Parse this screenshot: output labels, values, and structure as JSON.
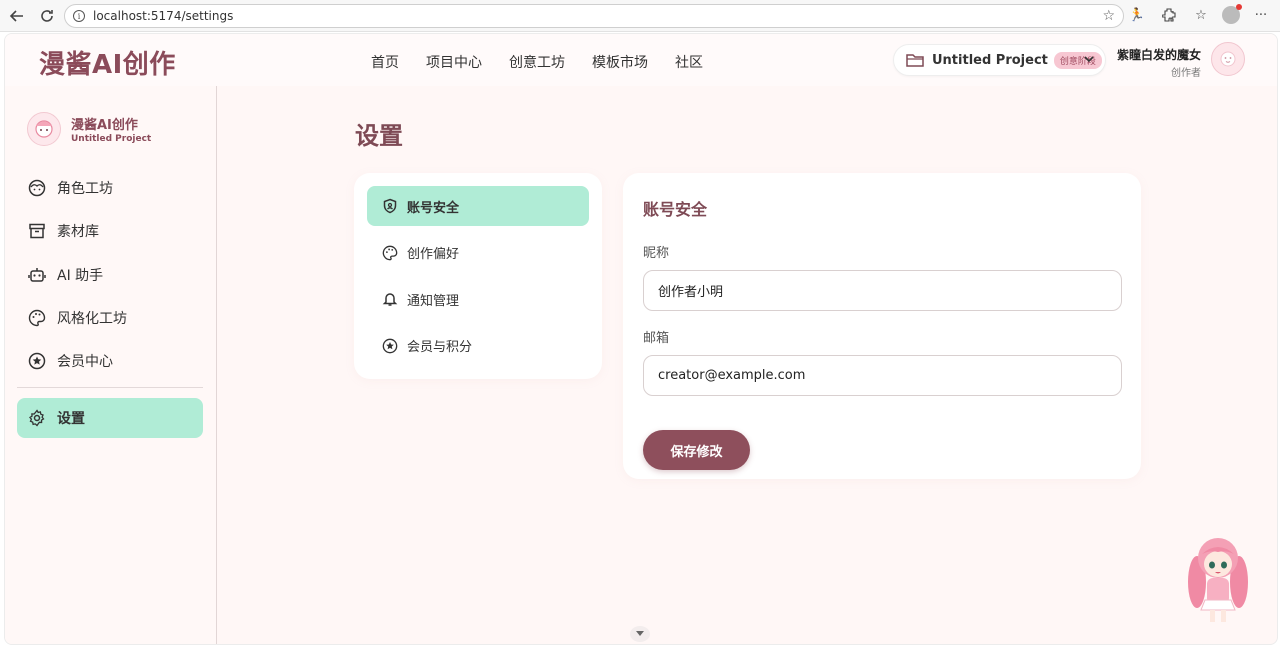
{
  "browser": {
    "url": "localhost:5174/settings"
  },
  "header": {
    "brand": "漫酱AI创作",
    "nav": [
      "首页",
      "项目中心",
      "创意工坊",
      "模板市场",
      "社区"
    ],
    "project": {
      "name": "Untitled Project",
      "stage": "创意阶段"
    },
    "user": {
      "name": "紫瞳白发的魔女",
      "role": "创作者"
    }
  },
  "sidebar": {
    "brand": "漫酱AI创作",
    "project": "Untitled Project",
    "items": [
      {
        "label": "角色工坊",
        "icon": "face-icon"
      },
      {
        "label": "素材库",
        "icon": "archive-icon"
      },
      {
        "label": "AI 助手",
        "icon": "robot-icon"
      },
      {
        "label": "风格化工坊",
        "icon": "palette-icon"
      },
      {
        "label": "会员中心",
        "icon": "star-circle-icon"
      }
    ],
    "active_item": {
      "label": "设置",
      "icon": "gear-icon"
    }
  },
  "page": {
    "title": "设置",
    "tabs": [
      {
        "label": "账号安全",
        "icon": "shield-icon",
        "active": true
      },
      {
        "label": "创作偏好",
        "icon": "palette-icon",
        "active": false
      },
      {
        "label": "通知管理",
        "icon": "bell-icon",
        "active": false
      },
      {
        "label": "会员与积分",
        "icon": "star-circle-icon",
        "active": false
      }
    ],
    "form": {
      "title": "账号安全",
      "nickname_label": "昵称",
      "nickname_value": "创作者小明",
      "email_label": "邮箱",
      "email_value": "creator@example.com",
      "save_label": "保存修改"
    }
  },
  "colors": {
    "accent": "#8e4f5c",
    "active_bg": "#b0ecd6",
    "brand": "#8b4b5a",
    "background": "#fff7f6"
  }
}
